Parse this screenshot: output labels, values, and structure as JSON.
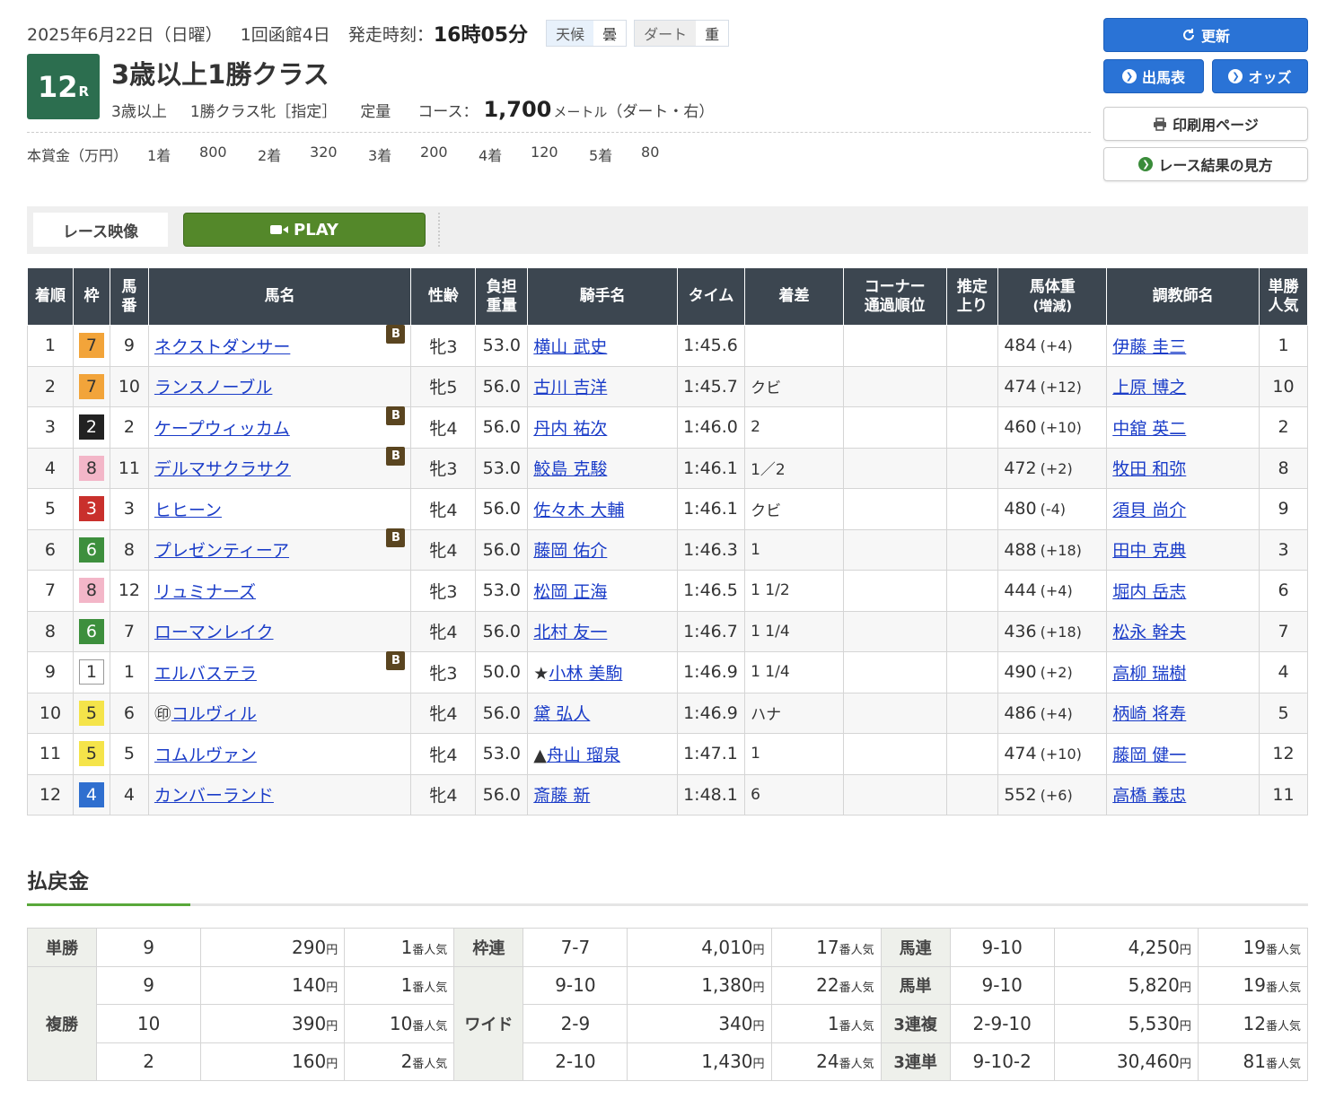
{
  "header": {
    "date": "2025年6月22日（日曜）",
    "meeting": "1回函館4日",
    "post_time_label": "発走時刻：",
    "post_time": "16時05分",
    "weather_label": "天候",
    "weather": "曇",
    "track_label": "ダート",
    "track_cond": "重",
    "race_no": "12",
    "race_no_suffix": "R",
    "race_name": "3歳以上1勝クラス",
    "age": "3歳以上",
    "cls": "1勝クラス牝［指定］",
    "weight_rule": "定量",
    "course_label": "コース：",
    "distance": "1,700",
    "dist_unit": "メートル",
    "course_detail": "（ダート・右）"
  },
  "prize": {
    "label": "本賞金（万円）",
    "items": [
      {
        "ord": "1着",
        "amt": "800"
      },
      {
        "ord": "2着",
        "amt": "320"
      },
      {
        "ord": "3着",
        "amt": "200"
      },
      {
        "ord": "4着",
        "amt": "120"
      },
      {
        "ord": "5着",
        "amt": "80"
      }
    ]
  },
  "buttons": {
    "refresh": "更新",
    "entries": "出馬表",
    "odds": "オッズ",
    "print": "印刷用ページ",
    "guide": "レース結果の見方"
  },
  "video": {
    "label": "レース映像",
    "play": "PLAY"
  },
  "table": {
    "headers": [
      "着順",
      "枠",
      "馬番",
      "馬名",
      "性齢",
      "負担重量",
      "騎手名",
      "タイム",
      "着差",
      "コーナー通過順位",
      "推定上り",
      "馬体重（増減）",
      "調教師名",
      "単勝人気"
    ],
    "rows": [
      {
        "pos": "1",
        "waku": "7",
        "num": "9",
        "mark": "",
        "horse": "ネクストダンサー",
        "blinker": "B",
        "sexage": "牝3",
        "wt": "53.0",
        "jmark": "",
        "jockey": "横山 武史",
        "time": "1:45.6",
        "margin": "",
        "corner": "",
        "last3f": "",
        "bw": "484",
        "bwd": "(+4)",
        "trainer": "伊藤 圭三",
        "pop": "1"
      },
      {
        "pos": "2",
        "waku": "7",
        "num": "10",
        "mark": "",
        "horse": "ランスノーブル",
        "blinker": "",
        "sexage": "牝5",
        "wt": "56.0",
        "jmark": "",
        "jockey": "古川 吉洋",
        "time": "1:45.7",
        "margin": "クビ",
        "corner": "",
        "last3f": "",
        "bw": "474",
        "bwd": "(+12)",
        "trainer": "上原 博之",
        "pop": "10"
      },
      {
        "pos": "3",
        "waku": "2",
        "num": "2",
        "mark": "",
        "horse": "ケープウィッカム",
        "blinker": "B",
        "sexage": "牝4",
        "wt": "56.0",
        "jmark": "",
        "jockey": "丹内 祐次",
        "time": "1:46.0",
        "margin": "2",
        "corner": "",
        "last3f": "",
        "bw": "460",
        "bwd": "(+10)",
        "trainer": "中舘 英二",
        "pop": "2"
      },
      {
        "pos": "4",
        "waku": "8",
        "num": "11",
        "mark": "",
        "horse": "デルマサクラサク",
        "blinker": "B",
        "sexage": "牝3",
        "wt": "53.0",
        "jmark": "",
        "jockey": "鮫島 克駿",
        "time": "1:46.1",
        "margin": "1／2",
        "corner": "",
        "last3f": "",
        "bw": "472",
        "bwd": "(+2)",
        "trainer": "牧田 和弥",
        "pop": "8"
      },
      {
        "pos": "5",
        "waku": "3",
        "num": "3",
        "mark": "",
        "horse": "ヒヒーン",
        "blinker": "",
        "sexage": "牝4",
        "wt": "56.0",
        "jmark": "",
        "jockey": "佐々木 大輔",
        "time": "1:46.1",
        "margin": "クビ",
        "corner": "",
        "last3f": "",
        "bw": "480",
        "bwd": "(-4)",
        "trainer": "須貝 尚介",
        "pop": "9"
      },
      {
        "pos": "6",
        "waku": "6",
        "num": "8",
        "mark": "",
        "horse": "プレゼンティーア",
        "blinker": "B",
        "sexage": "牝4",
        "wt": "56.0",
        "jmark": "",
        "jockey": "藤岡 佑介",
        "time": "1:46.3",
        "margin": "1",
        "corner": "",
        "last3f": "",
        "bw": "488",
        "bwd": "(+18)",
        "trainer": "田中 克典",
        "pop": "3"
      },
      {
        "pos": "7",
        "waku": "8",
        "num": "12",
        "mark": "",
        "horse": "リュミナーズ",
        "blinker": "",
        "sexage": "牝3",
        "wt": "53.0",
        "jmark": "",
        "jockey": "松岡 正海",
        "time": "1:46.5",
        "margin": "1 1/2",
        "corner": "",
        "last3f": "",
        "bw": "444",
        "bwd": "(+4)",
        "trainer": "堀内 岳志",
        "pop": "6"
      },
      {
        "pos": "8",
        "waku": "6",
        "num": "7",
        "mark": "",
        "horse": "ローマンレイク",
        "blinker": "",
        "sexage": "牝4",
        "wt": "56.0",
        "jmark": "",
        "jockey": "北村 友一",
        "time": "1:46.7",
        "margin": "1 1/4",
        "corner": "",
        "last3f": "",
        "bw": "436",
        "bwd": "(+18)",
        "trainer": "松永 幹夫",
        "pop": "7"
      },
      {
        "pos": "9",
        "waku": "1",
        "num": "1",
        "mark": "",
        "horse": "エルバステラ",
        "blinker": "B",
        "sexage": "牝3",
        "wt": "50.0",
        "jmark": "★",
        "jockey": "小林 美駒",
        "time": "1:46.9",
        "margin": "1 1/4",
        "corner": "",
        "last3f": "",
        "bw": "490",
        "bwd": "(+2)",
        "trainer": "高柳 瑞樹",
        "pop": "4"
      },
      {
        "pos": "10",
        "waku": "5",
        "num": "6",
        "mark": "㊞",
        "horse": "コルヴィル",
        "blinker": "",
        "sexage": "牝4",
        "wt": "56.0",
        "jmark": "",
        "jockey": "黛 弘人",
        "time": "1:46.9",
        "margin": "ハナ",
        "corner": "",
        "last3f": "",
        "bw": "486",
        "bwd": "(+4)",
        "trainer": "柄崎 将寿",
        "pop": "5"
      },
      {
        "pos": "11",
        "waku": "5",
        "num": "5",
        "mark": "",
        "horse": "コムルヴァン",
        "blinker": "",
        "sexage": "牝4",
        "wt": "53.0",
        "jmark": "▲",
        "jockey": "舟山 瑠泉",
        "time": "1:47.1",
        "margin": "1",
        "corner": "",
        "last3f": "",
        "bw": "474",
        "bwd": "(+10)",
        "trainer": "藤岡 健一",
        "pop": "12"
      },
      {
        "pos": "12",
        "waku": "4",
        "num": "4",
        "mark": "",
        "horse": "カンバーランド",
        "blinker": "",
        "sexage": "牝4",
        "wt": "56.0",
        "jmark": "",
        "jockey": "斎藤 新",
        "time": "1:48.1",
        "margin": "6",
        "corner": "",
        "last3f": "",
        "bw": "552",
        "bwd": "(+6)",
        "trainer": "高橋 義忠",
        "pop": "11"
      }
    ]
  },
  "waku_colors": {
    "1": {
      "bg": "#ffffff",
      "fg": "#333333",
      "border": "#999999"
    },
    "2": {
      "bg": "#222222",
      "fg": "#ffffff",
      "border": "#222222"
    },
    "3": {
      "bg": "#c9302c",
      "fg": "#ffffff",
      "border": "#c9302c"
    },
    "4": {
      "bg": "#2f6fcf",
      "fg": "#ffffff",
      "border": "#2f6fcf"
    },
    "5": {
      "bg": "#f5e44a",
      "fg": "#333333",
      "border": "#f5e44a"
    },
    "6": {
      "bg": "#3d8f3d",
      "fg": "#ffffff",
      "border": "#3d8f3d"
    },
    "7": {
      "bg": "#f2a43a",
      "fg": "#333333",
      "border": "#f2a43a"
    },
    "8": {
      "bg": "#f3b6c8",
      "fg": "#333333",
      "border": "#f3b6c8"
    }
  },
  "payout": {
    "title": "払戻金",
    "yen": "円",
    "ninki": "番人気",
    "blocks": [
      {
        "label": "単勝",
        "rows": [
          {
            "combo": "9",
            "amt": "290",
            "pop": "1"
          }
        ]
      },
      {
        "label": "複勝",
        "rows": [
          {
            "combo": "9",
            "amt": "140",
            "pop": "1"
          },
          {
            "combo": "10",
            "amt": "390",
            "pop": "10"
          },
          {
            "combo": "2",
            "amt": "160",
            "pop": "2"
          }
        ]
      },
      {
        "label": "枠連",
        "rows": [
          {
            "combo": "7-7",
            "amt": "4,010",
            "pop": "17"
          }
        ]
      },
      {
        "label": "ワイド",
        "rows": [
          {
            "combo": "9-10",
            "amt": "1,380",
            "pop": "22"
          },
          {
            "combo": "2-9",
            "amt": "340",
            "pop": "1"
          },
          {
            "combo": "2-10",
            "amt": "1,430",
            "pop": "24"
          }
        ]
      },
      {
        "label": "馬連",
        "rows": [
          {
            "combo": "9-10",
            "amt": "4,250",
            "pop": "19"
          }
        ]
      },
      {
        "label": "馬単",
        "rows": [
          {
            "combo": "9-10",
            "amt": "5,820",
            "pop": "19"
          }
        ]
      },
      {
        "label": "3連複",
        "rows": [
          {
            "combo": "2-9-10",
            "amt": "5,530",
            "pop": "12"
          }
        ]
      },
      {
        "label": "3連単",
        "rows": [
          {
            "combo": "9-10-2",
            "amt": "30,460",
            "pop": "81"
          }
        ]
      }
    ]
  }
}
